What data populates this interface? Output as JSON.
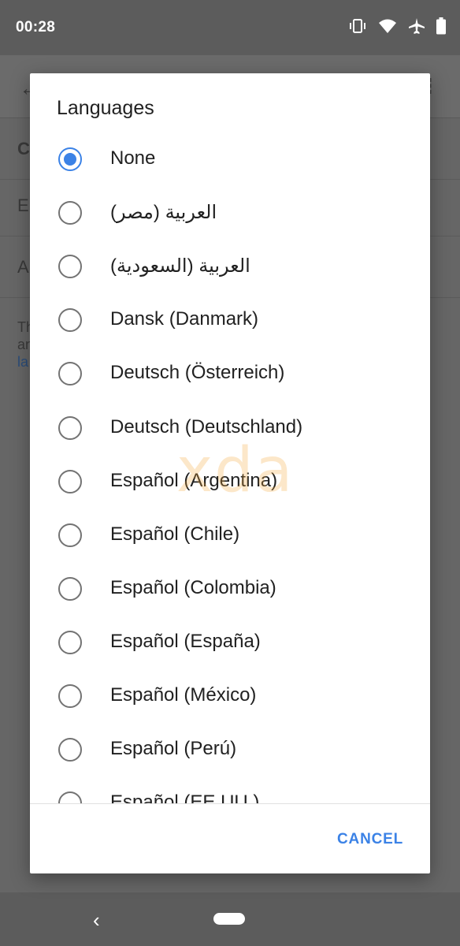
{
  "status_bar": {
    "time": "00:28",
    "icons": [
      "vibrate-icon",
      "wifi-icon",
      "airplane-icon",
      "battery-icon"
    ]
  },
  "underlay": {
    "rows": [
      {
        "text": "Ch"
      },
      {
        "text": "En"
      },
      {
        "text": "A"
      }
    ],
    "paragraph_lines": [
      "Th",
      "an"
    ],
    "paragraph_link": "la"
  },
  "dialog": {
    "title": "Languages",
    "options": [
      {
        "label": "None",
        "selected": true
      },
      {
        "label": "العربية (مصر)",
        "selected": false
      },
      {
        "label": "العربية (السعودية)",
        "selected": false
      },
      {
        "label": "Dansk (Danmark)",
        "selected": false
      },
      {
        "label": "Deutsch (Österreich)",
        "selected": false
      },
      {
        "label": "Deutsch (Deutschland)",
        "selected": false
      },
      {
        "label": "Español (Argentina)",
        "selected": false
      },
      {
        "label": "Español (Chile)",
        "selected": false
      },
      {
        "label": "Español (Colombia)",
        "selected": false
      },
      {
        "label": "Español (España)",
        "selected": false
      },
      {
        "label": "Español (México)",
        "selected": false
      },
      {
        "label": "Español (Perú)",
        "selected": false
      },
      {
        "label": "Español (EE.UU.)",
        "selected": false
      }
    ],
    "cancel_label": "CANCEL"
  },
  "watermark": "xda",
  "colors": {
    "accent": "#3b82e6",
    "scrim": "#616161"
  }
}
